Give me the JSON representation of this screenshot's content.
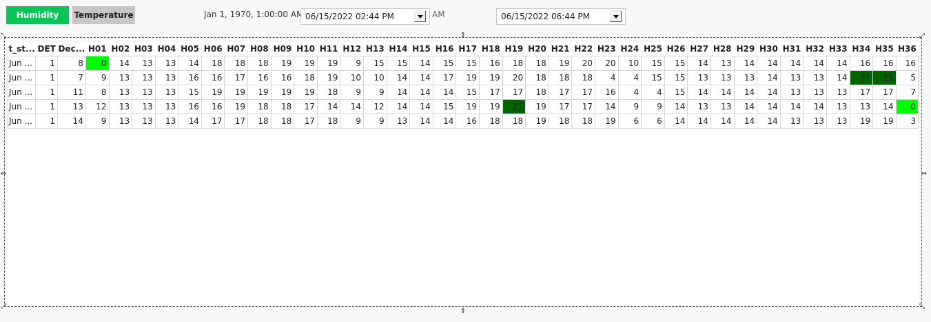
{
  "toolbar": {
    "humidity_label": "Humidity",
    "temperature_label": "Temperature",
    "epoch_text": "Jan 1, 1970, 1:00:00 AM",
    "ghost_text": "AM",
    "start_datetime": "06/15/2022 02:44 PM",
    "end_datetime": "06/15/2022 06:44 PM"
  },
  "colors": {
    "active_button": "#0bc45a",
    "highlight_low": "#00ff00",
    "highlight_high": "#006400"
  },
  "table": {
    "columns": [
      "t_st...",
      "DET",
      "Dec...",
      "H01",
      "H02",
      "H03",
      "H04",
      "H05",
      "H06",
      "H07",
      "H08",
      "H09",
      "H10",
      "H11",
      "H12",
      "H13",
      "H14",
      "H15",
      "H16",
      "H17",
      "H18",
      "H19",
      "H20",
      "H21",
      "H22",
      "H23",
      "H24",
      "H25",
      "H26",
      "H27",
      "H28",
      "H29",
      "H30",
      "H31",
      "H32",
      "H33",
      "H34",
      "H35",
      "H36"
    ],
    "rows": [
      [
        "Jun ...",
        "1",
        "8",
        "0",
        "14",
        "13",
        "13",
        "14",
        "18",
        "18",
        "18",
        "19",
        "19",
        "19",
        "9",
        "15",
        "15",
        "14",
        "15",
        "15",
        "16",
        "18",
        "18",
        "19",
        "20",
        "20",
        "10",
        "15",
        "15",
        "14",
        "13",
        "14",
        "14",
        "14",
        "14",
        "14",
        "16",
        "16",
        "16"
      ],
      [
        "Jun ...",
        "1",
        "7",
        "9",
        "13",
        "13",
        "13",
        "16",
        "16",
        "17",
        "16",
        "16",
        "18",
        "19",
        "10",
        "10",
        "14",
        "14",
        "17",
        "19",
        "19",
        "20",
        "18",
        "18",
        "18",
        "4",
        "4",
        "15",
        "15",
        "13",
        "13",
        "13",
        "14",
        "13",
        "13",
        "14",
        "31",
        "21",
        "5"
      ],
      [
        "Jun ...",
        "1",
        "11",
        "8",
        "13",
        "13",
        "13",
        "15",
        "19",
        "19",
        "19",
        "19",
        "19",
        "18",
        "9",
        "9",
        "14",
        "14",
        "14",
        "15",
        "17",
        "17",
        "18",
        "17",
        "17",
        "16",
        "4",
        "4",
        "15",
        "14",
        "14",
        "14",
        "14",
        "13",
        "13",
        "13",
        "17",
        "17",
        "7"
      ],
      [
        "Jun ...",
        "1",
        "13",
        "12",
        "13",
        "13",
        "13",
        "16",
        "16",
        "19",
        "18",
        "18",
        "17",
        "14",
        "14",
        "12",
        "14",
        "14",
        "15",
        "19",
        "19",
        "21",
        "19",
        "17",
        "17",
        "14",
        "9",
        "9",
        "14",
        "13",
        "13",
        "14",
        "14",
        "14",
        "14",
        "13",
        "13",
        "14",
        "0"
      ],
      [
        "Jun ...",
        "1",
        "14",
        "9",
        "13",
        "13",
        "13",
        "14",
        "17",
        "17",
        "18",
        "18",
        "17",
        "18",
        "9",
        "9",
        "13",
        "14",
        "14",
        "16",
        "18",
        "18",
        "19",
        "18",
        "18",
        "19",
        "6",
        "6",
        "14",
        "14",
        "14",
        "14",
        "14",
        "13",
        "13",
        "13",
        "19",
        "19",
        "3"
      ]
    ],
    "highlights": [
      {
        "row": 0,
        "col": 3,
        "level": "low"
      },
      {
        "row": 1,
        "col": 36,
        "level": "high"
      },
      {
        "row": 1,
        "col": 37,
        "level": "high"
      },
      {
        "row": 3,
        "col": 21,
        "level": "high"
      },
      {
        "row": 3,
        "col": 38,
        "level": "low"
      }
    ]
  },
  "handles": {
    "resize_nw_icon": "⤡",
    "resize_n_icon": "⇕",
    "resize_ne_icon": "⤢",
    "resize_w_icon": "⇔",
    "resize_e_icon": "⇔",
    "resize_sw_icon": "⤢",
    "resize_s_icon": "⇕",
    "resize_se_icon": "⤡"
  }
}
